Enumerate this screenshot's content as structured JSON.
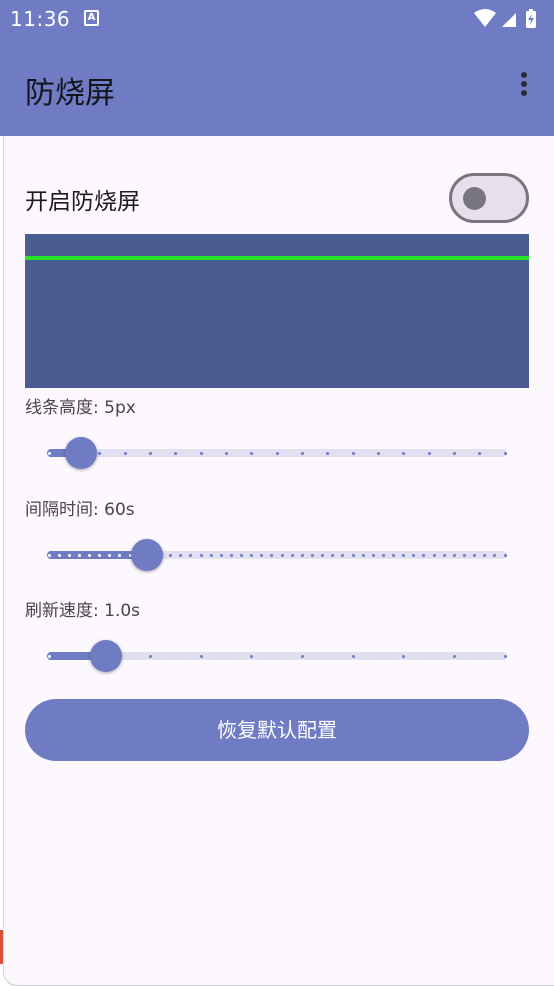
{
  "status_bar": {
    "time": "11:36",
    "notification_letter": "A"
  },
  "app_bar": {
    "title": "防烧屏",
    "menu_icon": "more-vert-icon"
  },
  "burn_in": {
    "toggle_label": "开启防烧屏",
    "enabled": false,
    "preview_bg_color": "#4b5c92",
    "preview_line_color": "#24e424"
  },
  "sliders": [
    {
      "id": "line-height",
      "label": "线条高度: 5px",
      "min": 0,
      "max": 18,
      "value": 1,
      "ticks": 19
    },
    {
      "id": "interval",
      "label": "间隔时间: 60s",
      "min": 0,
      "max": 45,
      "value": 9,
      "ticks": 46
    },
    {
      "id": "refresh",
      "label": "刷新速度: 1.0s",
      "min": 0,
      "max": 9,
      "value": 1,
      "ticks": 10
    }
  ],
  "reset_button": {
    "label": "恢复默认配置"
  },
  "colors": {
    "primary": "#6f7cc4",
    "surface": "#fdf8fd",
    "track_inactive": "#e1dff0"
  }
}
